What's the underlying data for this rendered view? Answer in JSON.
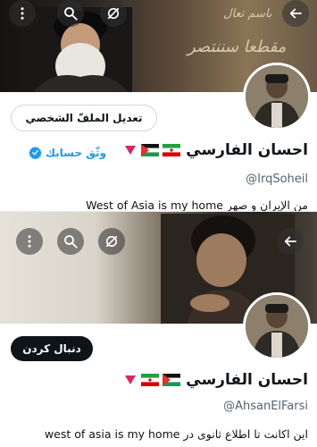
{
  "profile_top": {
    "display_name": "احسان الفارسي",
    "handle": "@IrqSoheil",
    "bio": "West of Asia is my home من الإيران و صهر",
    "action_button": "تعديل الملفّ الشخصي",
    "verify_link": "وثّق حسابك",
    "calligraphy_line1": "باسم تعال",
    "calligraphy_line2": "مقطعا سننتصر",
    "icons": [
      "back-arrow-icon",
      "hide-icon",
      "search-icon",
      "more-icon",
      "verified-badge-icon",
      "red-triangle-icon",
      "flag-iran-icon",
      "flag-palestine-icon"
    ]
  },
  "profile_bottom": {
    "display_name": "احسان الفارسي",
    "handle": "@AhsanElFarsi",
    "bio": "west of asia is my home اين اكانت تا اطلاع ثانوی در",
    "action_button": "دنبال کردن",
    "icons": [
      "back-arrow-icon",
      "hide-icon",
      "search-icon",
      "more-icon",
      "red-triangle-icon",
      "flag-iran-icon",
      "flag-palestine-icon"
    ]
  },
  "colors": {
    "accent_blue": "#1d9bf0",
    "text_primary": "#0f1419",
    "text_secondary": "#536471",
    "follow_button_bg": "#0f1419"
  }
}
